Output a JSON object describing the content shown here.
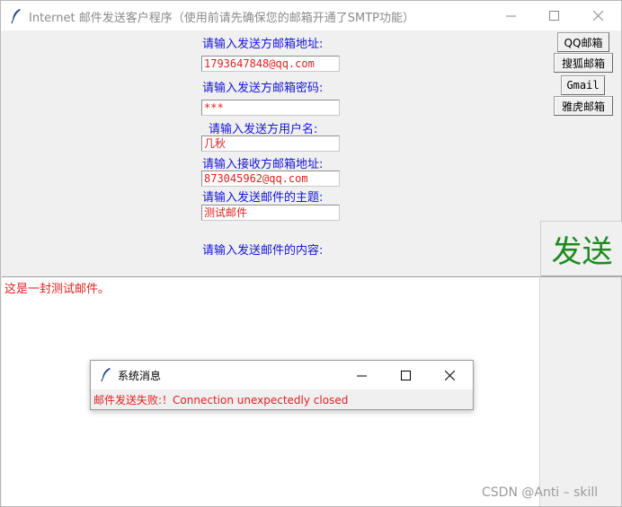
{
  "window": {
    "title": "Internet 邮件发送客户程序（使用前请先确保您的邮箱开通了SMTP功能）"
  },
  "form": {
    "sender_email_label": "请输入发送方邮箱地址:",
    "sender_email_value": "1793647848@qq.com",
    "sender_password_label": "请输入发送方邮箱密码:",
    "sender_password_value": "***",
    "sender_username_label": "请输入发送方用户名:",
    "sender_username_value": "几秋",
    "recipient_email_label": "请输入接收方邮箱地址:",
    "recipient_email_value": "873045962@qq.com",
    "subject_label": "请输入发送邮件的主题:",
    "subject_value": "测试邮件",
    "content_label": "请输入发送邮件的内容:",
    "content_value": "这是一封测试邮件。"
  },
  "providers": {
    "qq": "QQ邮箱",
    "sohu": "搜狐邮箱",
    "gmail": "Gmail",
    "yahoo": "雅虎邮箱"
  },
  "send_button": "发送",
  "dialog": {
    "title": "系统消息",
    "message": "邮件发送失败:！Connection unexpectedly closed"
  },
  "watermark": "CSDN @Anti – skill",
  "colors": {
    "label": "#1515d6",
    "value": "#e02020",
    "send": "#1e8a1e"
  }
}
